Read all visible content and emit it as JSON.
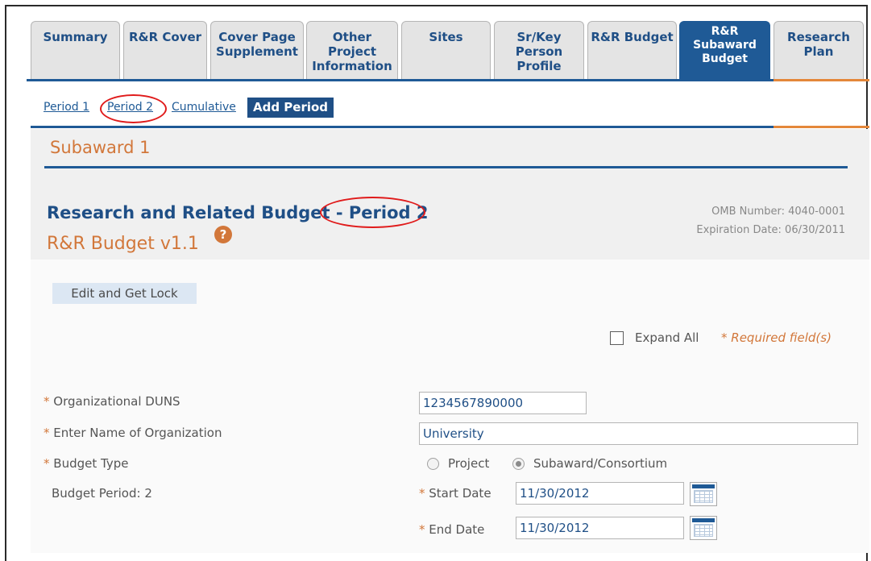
{
  "tabs": [
    {
      "label": "Summary"
    },
    {
      "label": "R&R Cover"
    },
    {
      "label": "Cover Page\nSupplement"
    },
    {
      "label": "Other\nProject\nInformation"
    },
    {
      "label": "Sites"
    },
    {
      "label": "Sr/Key\nPerson\nProfile"
    },
    {
      "label": "R&R Budget"
    },
    {
      "label": "R&R\nSubaward\nBudget",
      "active": true
    },
    {
      "label": "Research\nPlan"
    }
  ],
  "period_nav": {
    "period1": "Period 1",
    "period2": "Period 2",
    "cumulative": "Cumulative",
    "add_period": "Add Period"
  },
  "section": {
    "subaward_title": "Subaward 1"
  },
  "form_header": {
    "title": "Research and Related Budget - Period 2",
    "version": "R&R Budget v1.1",
    "help_icon": "?",
    "omb_number": "OMB Number: 4040-0001",
    "expiration": "Expiration Date: 06/30/2011"
  },
  "actions": {
    "edit_lock": "Edit and Get Lock",
    "expand_all": "Expand All",
    "required_note": "* Required field(s)"
  },
  "fields": {
    "duns_label": "Organizational DUNS",
    "duns_value": "1234567890000",
    "org_name_label": "Enter Name of Organization",
    "org_name_value": "University",
    "budget_type_label": "Budget Type",
    "budget_type_options": [
      "Project",
      "Subaward/Consortium"
    ],
    "budget_type_selected": "Subaward/Consortium",
    "budget_period_label": "Budget Period: 2",
    "start_date_label": "Start Date",
    "start_date_value": "11/30/2012",
    "end_date_label": "End Date",
    "end_date_value": "11/30/2012"
  },
  "colors": {
    "primary": "#1f5a96",
    "accent": "#d2773a",
    "annotation": "#e01b1b"
  },
  "icons": [
    "help-icon",
    "calendar-icon"
  ]
}
